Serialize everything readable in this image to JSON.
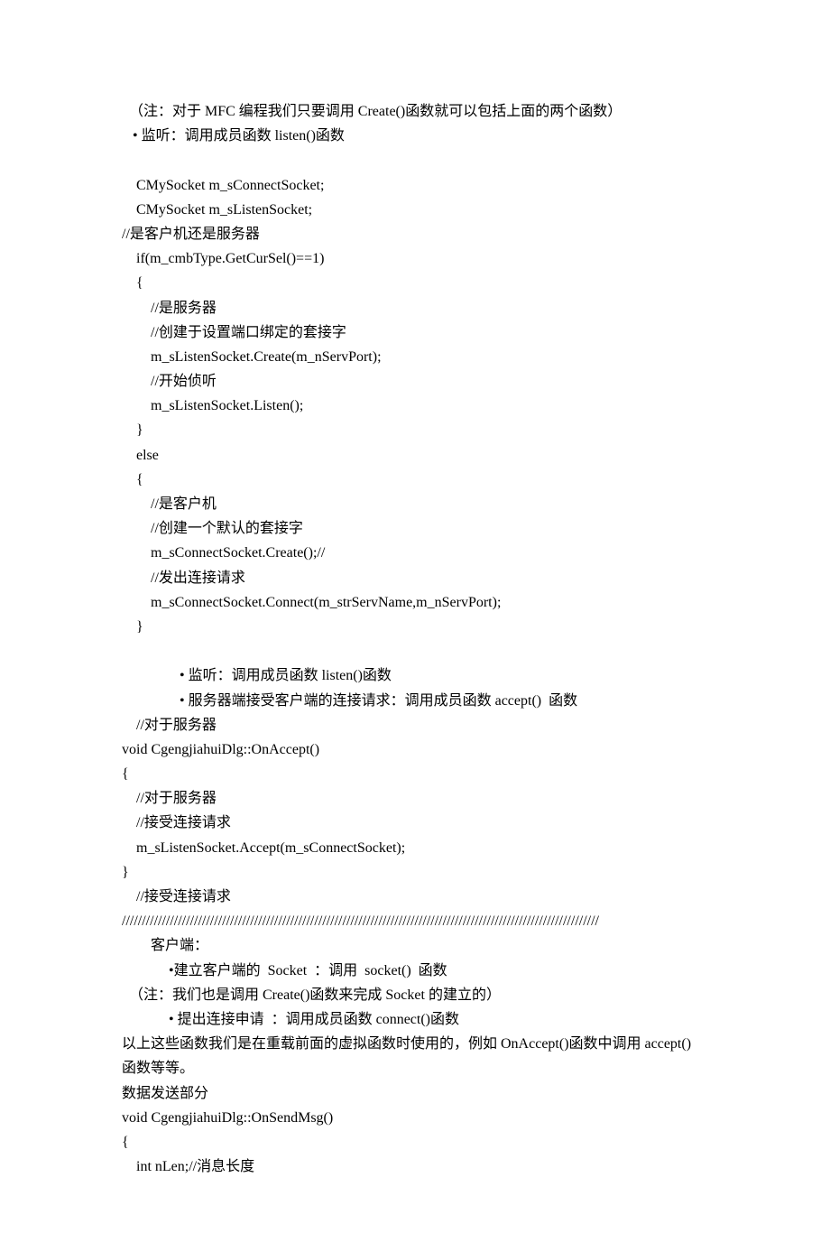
{
  "lines": [
    {
      "indent": 2,
      "text": "（注：对于 MFC 编程我们只要调用 Create()函数就可以包括上面的两个函数）"
    },
    {
      "indent": 3,
      "text": "• 监听：调用成员函数 listen()函数"
    },
    {
      "indent": 0,
      "text": ""
    },
    {
      "indent": 4,
      "text": "CMySocket m_sConnectSocket;"
    },
    {
      "indent": 4,
      "text": "CMySocket m_sListenSocket;"
    },
    {
      "indent": 0,
      "text": "//是客户机还是服务器"
    },
    {
      "indent": 4,
      "text": "if(m_cmbType.GetCurSel()==1)"
    },
    {
      "indent": 4,
      "text": "{"
    },
    {
      "indent": 8,
      "text": "//是服务器"
    },
    {
      "indent": 8,
      "text": "//创建于设置端口绑定的套接字"
    },
    {
      "indent": 8,
      "text": "m_sListenSocket.Create(m_nServPort);"
    },
    {
      "indent": 8,
      "text": "//开始侦听"
    },
    {
      "indent": 8,
      "text": "m_sListenSocket.Listen();"
    },
    {
      "indent": 4,
      "text": "}"
    },
    {
      "indent": 4,
      "text": "else"
    },
    {
      "indent": 4,
      "text": "{"
    },
    {
      "indent": 8,
      "text": "//是客户机"
    },
    {
      "indent": 8,
      "text": "//创建一个默认的套接字"
    },
    {
      "indent": 8,
      "text": "m_sConnectSocket.Create();//"
    },
    {
      "indent": 8,
      "text": "//发出连接请求"
    },
    {
      "indent": 8,
      "text": "m_sConnectSocket.Connect(m_strServName,m_nServPort);"
    },
    {
      "indent": 4,
      "text": "}"
    },
    {
      "indent": 0,
      "text": ""
    },
    {
      "indent": 16,
      "text": "• 监听：调用成员函数 listen()函数"
    },
    {
      "indent": 16,
      "text": "• 服务器端接受客户端的连接请求：调用成员函数 accept()  函数"
    },
    {
      "indent": 4,
      "text": "//对于服务器"
    },
    {
      "indent": 0,
      "text": "void CgengjiahuiDlg::OnAccept()"
    },
    {
      "indent": 0,
      "text": "{"
    },
    {
      "indent": 4,
      "text": "//对于服务器"
    },
    {
      "indent": 4,
      "text": "//接受连接请求"
    },
    {
      "indent": 4,
      "text": "m_sListenSocket.Accept(m_sConnectSocket);"
    },
    {
      "indent": 0,
      "text": "}"
    },
    {
      "indent": 4,
      "text": "//接受连接请求"
    },
    {
      "indent": 0,
      "text": "///////////////////////////////////////////////////////////////////////////////////////////////////////////////////////"
    },
    {
      "indent": 8,
      "text": "客户端："
    },
    {
      "indent": 13,
      "text": "•建立客户端的  Socket  ：调用  socket()  函数"
    },
    {
      "indent": 2,
      "text": "（注：我们也是调用 Create()函数来完成 Socket 的建立的）"
    },
    {
      "indent": 13,
      "text": "• 提出连接申请  ：调用成员函数 connect()函数"
    },
    {
      "indent": 0,
      "text": "以上这些函数我们是在重载前面的虚拟函数时使用的，例如 OnAccept()函数中调用 accept()"
    },
    {
      "indent": 0,
      "text": "函数等等。"
    },
    {
      "indent": 0,
      "text": "数据发送部分"
    },
    {
      "indent": 0,
      "text": "void CgengjiahuiDlg::OnSendMsg()"
    },
    {
      "indent": 0,
      "text": "{"
    },
    {
      "indent": 4,
      "text": "int nLen;//消息长度"
    }
  ]
}
